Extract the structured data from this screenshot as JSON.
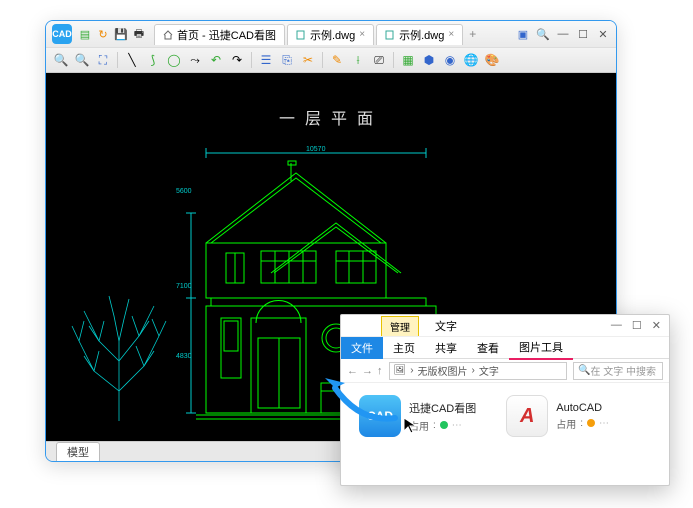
{
  "cad": {
    "app_icon_text": "CAD",
    "tabs": [
      {
        "label": "首页 - 迅捷CAD看图"
      },
      {
        "label": "示例.dwg"
      },
      {
        "label": "示例.dwg"
      }
    ],
    "drawing_title": "一层平面",
    "dims": {
      "d1": "10570",
      "d2": "5600",
      "d3": "7100",
      "d4": "4830"
    },
    "status_tab": "模型"
  },
  "explorer": {
    "manage_tab": "管理",
    "title_tab": "文字",
    "ribbon": {
      "file": "文件",
      "home": "主页",
      "share": "共享",
      "view": "查看",
      "pic_tools": "图片工具"
    },
    "breadcrumb": {
      "seg1": "无版权图片",
      "seg2": "文字"
    },
    "search_placeholder": "在 文字 中搜索",
    "items": [
      {
        "name": "迅捷CAD看图",
        "usage_label": "占用",
        "dot": "green"
      },
      {
        "name": "AutoCAD",
        "usage_label": "占用",
        "dot": "orange"
      }
    ]
  }
}
